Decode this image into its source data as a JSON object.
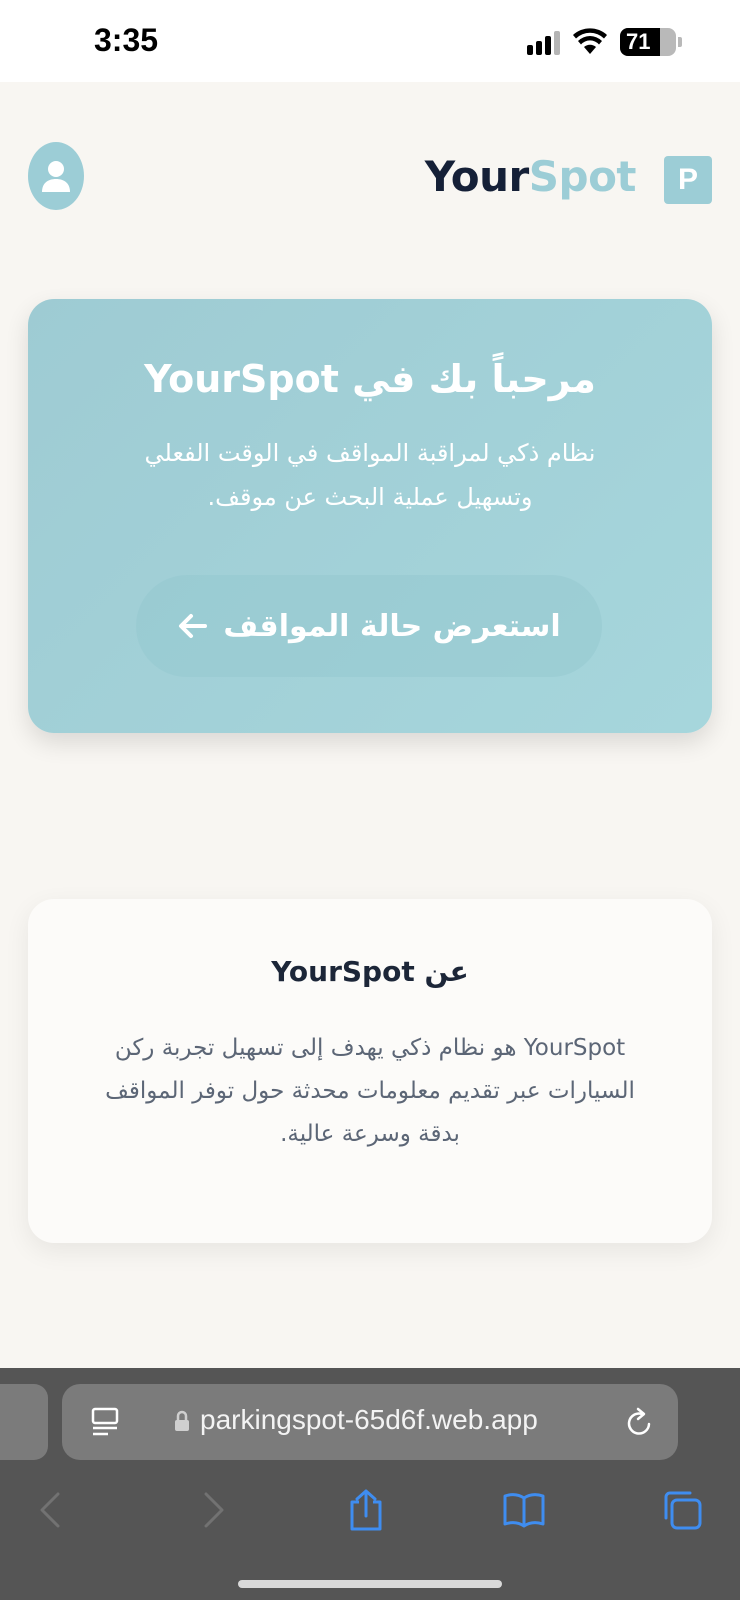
{
  "status_bar": {
    "time": "3:35",
    "battery": "71"
  },
  "header": {
    "brand_part1": "Your",
    "brand_part2": "Spot",
    "logo_letter": "P"
  },
  "hero": {
    "title": "مرحباً بك في YourSpot",
    "description_line1": "نظام ذكي لمراقبة المواقف في الوقت الفعلي",
    "description_line2": "وتسهيل عملية البحث عن موقف.",
    "button_label": "استعرض حالة المواقف"
  },
  "about": {
    "title": "عن YourSpot",
    "description": "YourSpot هو نظام ذكي يهدف إلى تسهيل تجربة ركن السيارات عبر تقديم معلومات محدثة حول توفر المواقف بدقة وسرعة عالية."
  },
  "browser": {
    "url": "parkingspot-65d6f.web.app"
  },
  "colors": {
    "accent": "#9ccdd6",
    "dark": "#152037",
    "background": "#f8f6f2"
  }
}
